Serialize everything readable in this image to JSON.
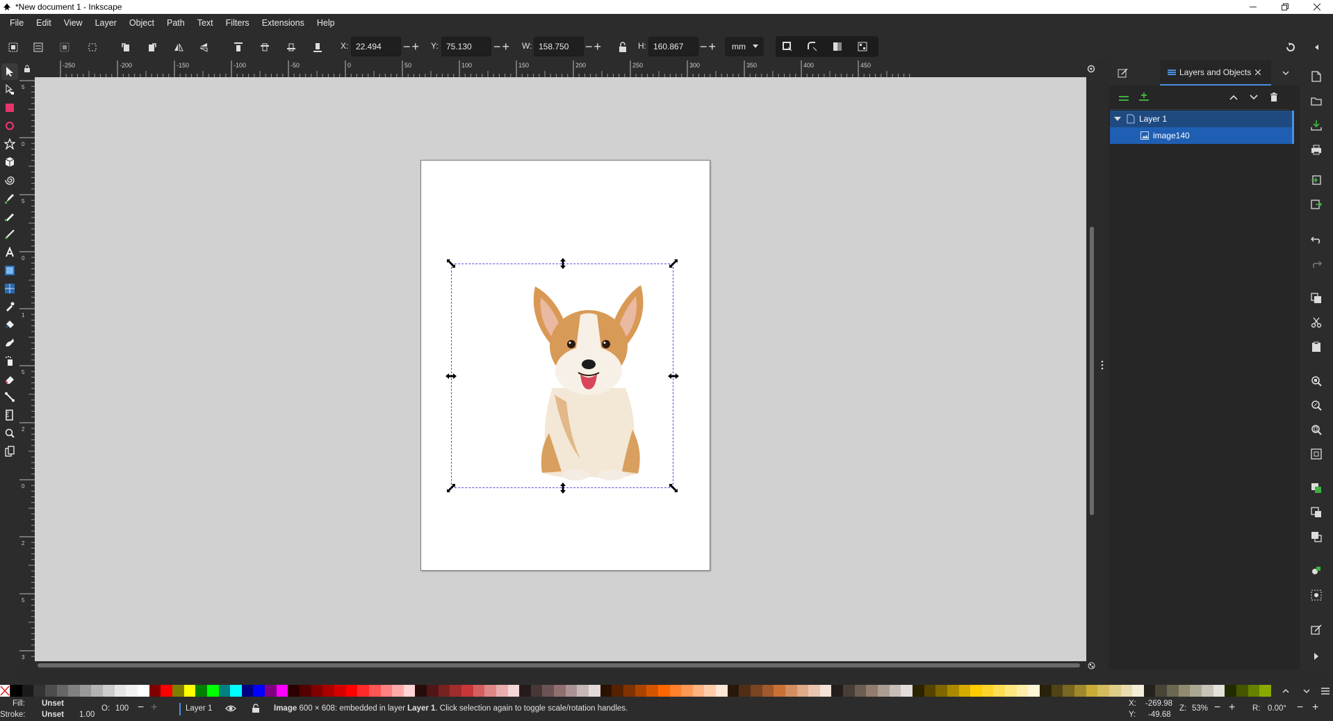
{
  "window": {
    "title": "*New document 1 - Inkscape",
    "controls": [
      "minimize-button",
      "restore-button",
      "close-button"
    ]
  },
  "menu": [
    "File",
    "Edit",
    "View",
    "Layer",
    "Object",
    "Path",
    "Text",
    "Filters",
    "Extensions",
    "Help"
  ],
  "toolbar": {
    "x_label": "X:",
    "x_value": "22.494",
    "y_label": "Y:",
    "y_value": "75.130",
    "w_label": "W:",
    "w_value": "158.750",
    "h_label": "H:",
    "h_value": "160.867",
    "unit": "mm",
    "minus": "−",
    "plus": "+"
  },
  "rulers": {
    "h_labels": [
      "-250",
      "-200",
      "-150",
      "-100",
      "-50",
      "0",
      "50",
      "100",
      "150",
      "200",
      "250",
      "300",
      "350",
      "400",
      "450"
    ],
    "v_labels": [
      "5",
      "0",
      "5",
      "0",
      "1",
      "5",
      "2",
      "0",
      "2",
      "5",
      "3"
    ]
  },
  "dock": {
    "tab_label": "Layers and Objects",
    "layers": [
      {
        "name": "Layer 1",
        "type": "layer"
      },
      {
        "name": "image140",
        "type": "image"
      }
    ]
  },
  "palette": {
    "colors": [
      "#000000",
      "#1a1a1a",
      "#333333",
      "#4d4d4d",
      "#666666",
      "#808080",
      "#999999",
      "#b3b3b3",
      "#cccccc",
      "#e6e6e6",
      "#f2f2f2",
      "#ffffff",
      "#800000",
      "#ff0000",
      "#808000",
      "#ffff00",
      "#008000",
      "#00ff00",
      "#008080",
      "#00ffff",
      "#000080",
      "#0000ff",
      "#800080",
      "#ff00ff",
      "#2b0000",
      "#550000",
      "#800000",
      "#aa0000",
      "#d40000",
      "#ff0000",
      "#ff2a2a",
      "#ff5555",
      "#ff8080",
      "#ffaaaa",
      "#ffd5d5",
      "#280b0b",
      "#501616",
      "#782121",
      "#a02c2c",
      "#c83737",
      "#d35f5f",
      "#de8787",
      "#e9afaf",
      "#f4d7d7",
      "#241c1c",
      "#483737",
      "#6c5353",
      "#916f6f",
      "#ac9393",
      "#c8b7b7",
      "#e3dbdb",
      "#2b1100",
      "#552200",
      "#803300",
      "#aa4400",
      "#d45500",
      "#ff6600",
      "#ff7f2a",
      "#ff9955",
      "#ffb380",
      "#ffccaa",
      "#ffe6d5",
      "#28170b",
      "#502d16",
      "#784421",
      "#a05a2c",
      "#c87137",
      "#d38d5f",
      "#deaa87",
      "#e9c6af",
      "#f4e3d7",
      "#241f1c",
      "#483e37",
      "#6c5d53",
      "#917c6f",
      "#ac9d93",
      "#c8beb7",
      "#e3dedb",
      "#2b2200",
      "#554400",
      "#806600",
      "#aa8800",
      "#d4aa00",
      "#ffcc00",
      "#ffd42a",
      "#ffdd55",
      "#ffe680",
      "#ffeeaa",
      "#fff6d5",
      "#28220b",
      "#504416",
      "#786721",
      "#a0892c",
      "#c8ab37",
      "#d3bc5f",
      "#decd87",
      "#e9ddaf",
      "#f4eed7",
      "#24221c",
      "#484537",
      "#6c6753",
      "#918a6f",
      "#aca793",
      "#c8c4b7",
      "#e3e2db",
      "#222b00",
      "#445500",
      "#668000",
      "#88aa00"
    ],
    "none_icon": "x-swatch-icon"
  },
  "status": {
    "fill_label": "Fill:",
    "fill_value": "Unset",
    "stroke_label": "Stroke:",
    "stroke_value": "Unset",
    "stroke_width": "1.00",
    "opacity_label": "O:",
    "opacity_value": "100",
    "layer_name": "Layer 1",
    "message_bold": "Image",
    "message_dims": " 600 × 608: embedded in layer ",
    "message_layer": "Layer 1",
    "message_rest": ". Click selection again to toggle scale/rotation handles.",
    "cursor_x_label": "X:",
    "cursor_x": "-269.98",
    "cursor_y_label": "Y:",
    "cursor_y": "-49.68",
    "zoom_label": "Z:",
    "zoom_value": "53%",
    "rotation_label": "R:",
    "rotation_value": "0.00°"
  },
  "colors": {
    "accent": "#4a90e2",
    "selection_row": "#1f5fb3",
    "selection_dash": "#5b4fd6",
    "canvas_bg": "#d1d1d1"
  }
}
